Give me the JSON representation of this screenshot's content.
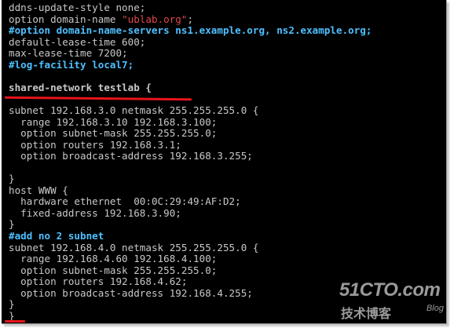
{
  "terminal": {
    "lines": [
      {
        "kind": "plain",
        "text": "ddns-update-style none;"
      },
      {
        "kind": "string",
        "pre": "option domain-name ",
        "str": "\"ublab.org\"",
        "post": ";"
      },
      {
        "kind": "comment",
        "text": "#option domain-name-servers ns1.example.org, ns2.example.org;"
      },
      {
        "kind": "plain",
        "text": "default-lease-time 600;"
      },
      {
        "kind": "plain",
        "text": "max-lease-time 7200;"
      },
      {
        "kind": "comment",
        "text": "#log-facility local7;"
      },
      {
        "kind": "plain",
        "text": ""
      },
      {
        "kind": "highlight",
        "text": "shared-network testlab {"
      },
      {
        "kind": "plain",
        "text": ""
      },
      {
        "kind": "plain",
        "text": "subnet 192.168.3.0 netmask 255.255.255.0 {"
      },
      {
        "kind": "plain",
        "text": "  range 192.168.3.10 192.168.3.100;"
      },
      {
        "kind": "plain",
        "text": "  option subnet-mask 255.255.255.0;"
      },
      {
        "kind": "plain",
        "text": "  option routers 192.168.3.1;"
      },
      {
        "kind": "plain",
        "text": "  option broadcast-address 192.168.3.255;"
      },
      {
        "kind": "plain",
        "text": ""
      },
      {
        "kind": "plain",
        "text": "}"
      },
      {
        "kind": "plain",
        "text": "host WWW {"
      },
      {
        "kind": "plain",
        "text": "  hardware ethernet  00:0C:29:49:AF:D2;"
      },
      {
        "kind": "plain",
        "text": "  fixed-address 192.168.3.90;"
      },
      {
        "kind": "plain",
        "text": "}"
      },
      {
        "kind": "comment",
        "text": "#add no 2 subnet"
      },
      {
        "kind": "plain",
        "text": "subnet 192.168.4.0 netmask 255.255.255.0 {"
      },
      {
        "kind": "plain",
        "text": "  range 192.168.4.60 192.168.4.100;"
      },
      {
        "kind": "plain",
        "text": "  option subnet-mask 255.255.255.0;"
      },
      {
        "kind": "plain",
        "text": "  option routers 192.168.4.62;"
      },
      {
        "kind": "plain",
        "text": "  option broadcast-address 192.168.4.255;"
      },
      {
        "kind": "plain",
        "text": "}"
      },
      {
        "kind": "plain",
        "text": "}"
      }
    ]
  },
  "watermark": {
    "brand": "51CTO.com",
    "sub": "技术博客",
    "blog": "Blog"
  },
  "colors": {
    "terminal_bg": "#000000",
    "text": "#c8c8c8",
    "comment": "#4ec0ff",
    "string": "#e04848",
    "annotation": "#e8141c"
  }
}
